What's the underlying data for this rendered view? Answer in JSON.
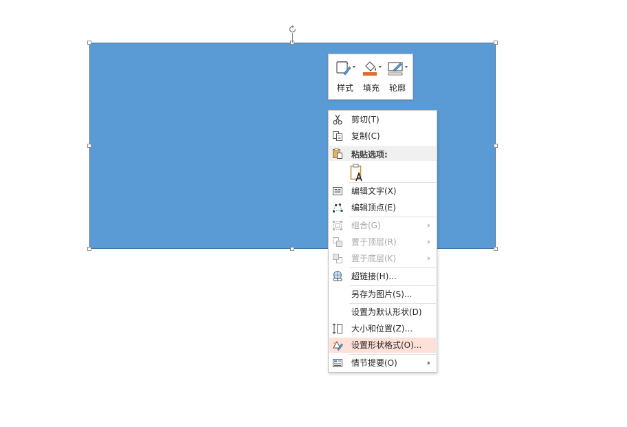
{
  "mini_toolbar": {
    "style_label": "样式",
    "fill_label": "填充",
    "outline_label": "轮廓",
    "fill_color": "#e36c2c"
  },
  "context_menu": {
    "cut": "剪切(T)",
    "copy": "复制(C)",
    "paste_options": "粘贴选项:",
    "edit_text": "编辑文字(X)",
    "edit_points": "编辑顶点(E)",
    "group": "组合(G)",
    "bring_to_front": "置于顶层(R)",
    "send_to_back": "置于底层(K)",
    "hyperlink": "超链接(H)...",
    "save_as_picture": "另存为图片(S)...",
    "set_default_shape": "设置为默认形状(D)",
    "size_and_position": "大小和位置(Z)...",
    "format_shape": "设置形状格式(O)...",
    "storyline": "情节提要(O)"
  },
  "colors": {
    "shape_fill": "#5b9bd5",
    "highlight": "#fde0d8"
  }
}
